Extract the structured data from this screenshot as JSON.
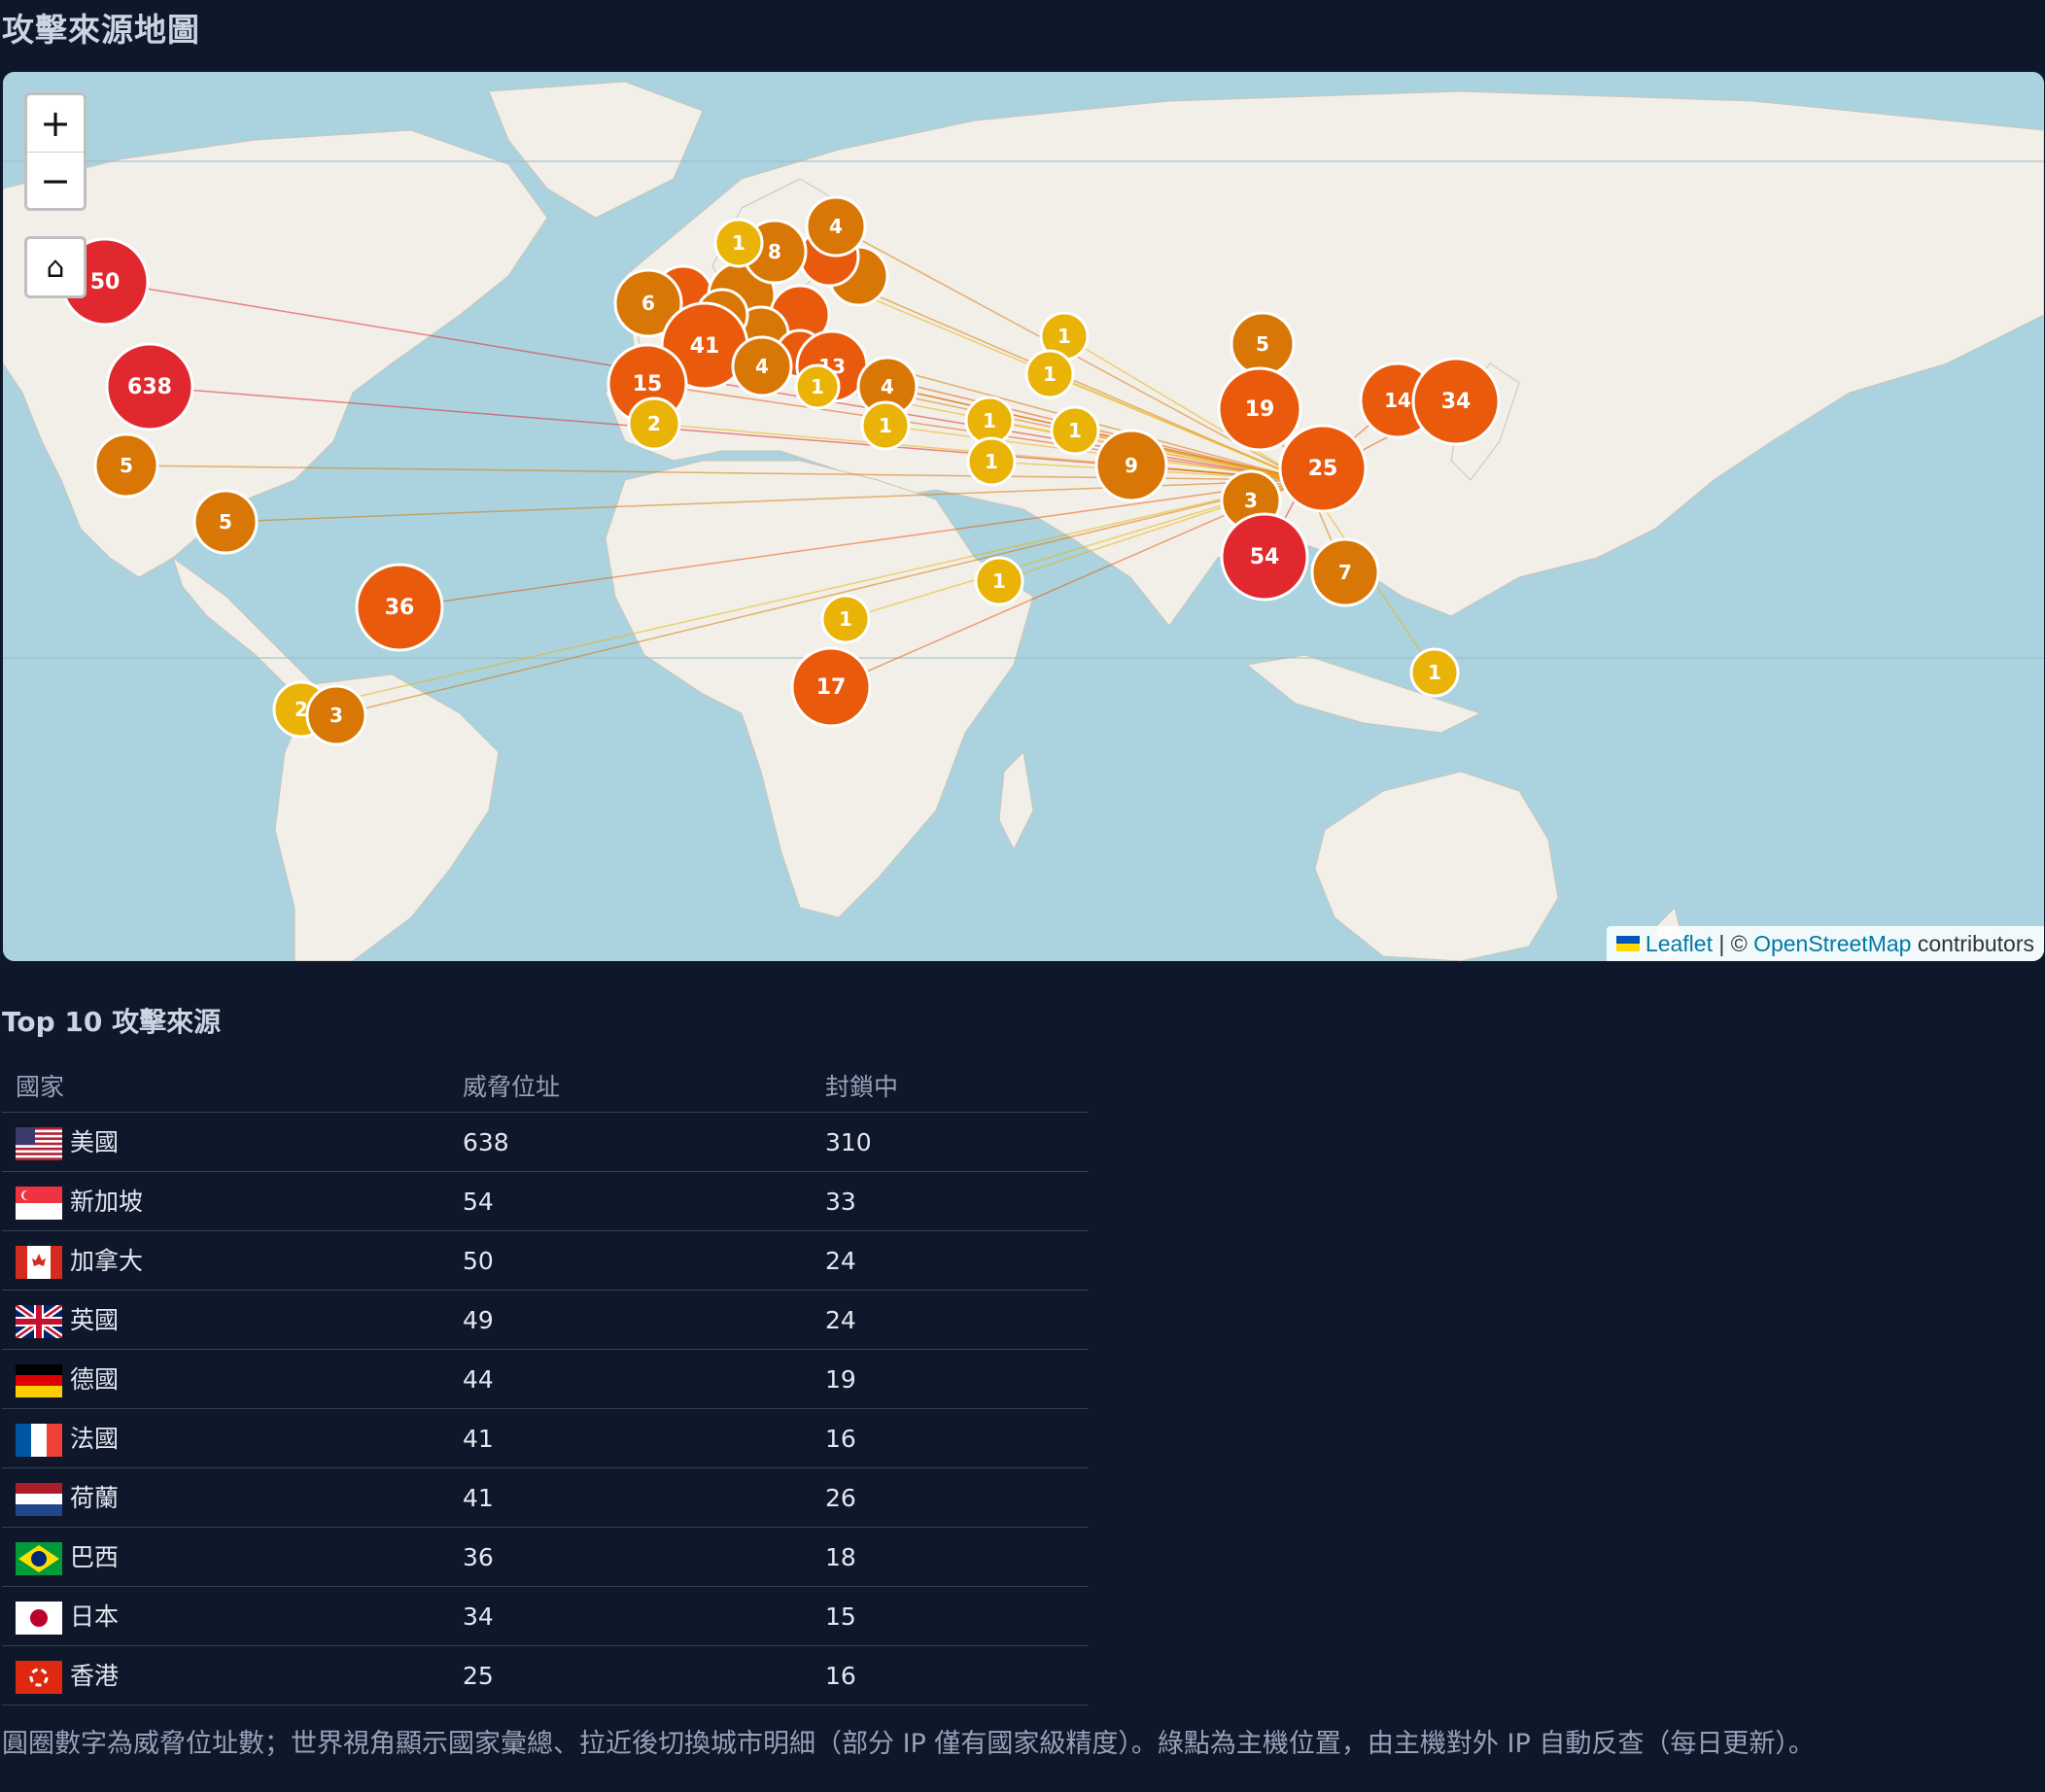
{
  "page_title": "攻擊來源地圖",
  "map": {
    "zoom_in": "+",
    "zoom_out": "−",
    "home": "⌂",
    "attribution": {
      "leaflet": "Leaflet",
      "sep": " | © ",
      "osm": "OpenStreetMap",
      "contributors": " contributors"
    },
    "colors": {
      "water": "#aad3df",
      "land": "#f2efe9",
      "high": "#e0282e",
      "mid": "#ea5a0c",
      "low": "#d97706",
      "single": "#eab308"
    },
    "host_marker_color": "#22c55e"
  },
  "clusters": [
    {
      "label": "50",
      "tier": "high"
    },
    {
      "label": "638",
      "tier": "high"
    },
    {
      "label": "5",
      "tier": "low"
    },
    {
      "label": "5",
      "tier": "low"
    },
    {
      "label": "36",
      "tier": "mid"
    },
    {
      "label": "2",
      "tier": "single"
    },
    {
      "label": "3",
      "tier": "low"
    },
    {
      "label": "4",
      "tier": "low"
    },
    {
      "label": "8",
      "tier": "low"
    },
    {
      "label": "1",
      "tier": "single"
    },
    {
      "label": "6",
      "tier": "low"
    },
    {
      "label": "41",
      "tier": "mid"
    },
    {
      "label": "15",
      "tier": "mid"
    },
    {
      "label": "2",
      "tier": "single"
    },
    {
      "label": "4",
      "tier": "low"
    },
    {
      "label": "13",
      "tier": "mid"
    },
    {
      "label": "1",
      "tier": "single"
    },
    {
      "label": "4",
      "tier": "low"
    },
    {
      "label": "1",
      "tier": "single"
    },
    {
      "label": "1",
      "tier": "single"
    },
    {
      "label": "1",
      "tier": "single"
    },
    {
      "label": "1",
      "tier": "single"
    },
    {
      "label": "1",
      "tier": "single"
    },
    {
      "label": "1",
      "tier": "single"
    },
    {
      "label": "9",
      "tier": "low"
    },
    {
      "label": "5",
      "tier": "low"
    },
    {
      "label": "19",
      "tier": "mid"
    },
    {
      "label": "14",
      "tier": "mid"
    },
    {
      "label": "34",
      "tier": "mid"
    },
    {
      "label": "25",
      "tier": "mid"
    },
    {
      "label": "3",
      "tier": "low"
    },
    {
      "label": "54",
      "tier": "high"
    },
    {
      "label": "7",
      "tier": "low"
    },
    {
      "label": "1",
      "tier": "single"
    },
    {
      "label": "1",
      "tier": "single"
    },
    {
      "label": "17",
      "tier": "mid"
    },
    {
      "label": "1",
      "tier": "single"
    }
  ],
  "top10": {
    "title": "Top 10 攻擊來源",
    "headers": {
      "country": "國家",
      "threat": "威脅位址",
      "blocked": "封鎖中"
    },
    "rows": [
      {
        "flag": "us",
        "country": "美國",
        "threat": "638",
        "blocked": "310"
      },
      {
        "flag": "sg",
        "country": "新加坡",
        "threat": "54",
        "blocked": "33"
      },
      {
        "flag": "ca",
        "country": "加拿大",
        "threat": "50",
        "blocked": "24"
      },
      {
        "flag": "gb",
        "country": "英國",
        "threat": "49",
        "blocked": "24"
      },
      {
        "flag": "de",
        "country": "德國",
        "threat": "44",
        "blocked": "19"
      },
      {
        "flag": "fr",
        "country": "法國",
        "threat": "41",
        "blocked": "16"
      },
      {
        "flag": "nl",
        "country": "荷蘭",
        "threat": "41",
        "blocked": "26"
      },
      {
        "flag": "br",
        "country": "巴西",
        "threat": "36",
        "blocked": "18"
      },
      {
        "flag": "jp",
        "country": "日本",
        "threat": "34",
        "blocked": "15"
      },
      {
        "flag": "hk",
        "country": "香港",
        "threat": "25",
        "blocked": "16"
      }
    ]
  },
  "footnote": "圓圈數字為威脅位址數；世界視角顯示國家彙總、拉近後切換城市明細（部分 IP 僅有國家級精度）。綠點為主機位置，由主機對外 IP 自動反查（每日更新）。"
}
